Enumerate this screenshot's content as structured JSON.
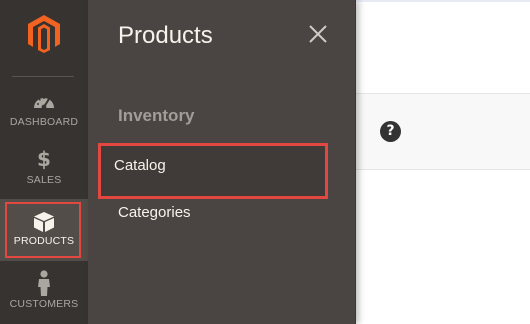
{
  "sidebar": {
    "logo_icon": "magento-logo",
    "items": [
      {
        "label": "DASHBOARD",
        "icon": "speedometer-icon",
        "active": false
      },
      {
        "label": "SALES",
        "icon": "dollar-icon",
        "active": false
      },
      {
        "label": "PRODUCTS",
        "icon": "box-icon",
        "active": true
      },
      {
        "label": "CUSTOMERS",
        "icon": "person-icon",
        "active": false
      }
    ]
  },
  "submenu": {
    "title": "Products",
    "close_icon": "close-icon",
    "section_title": "Inventory",
    "links": [
      {
        "label": "Catalog",
        "highlighted": true
      },
      {
        "label": "Categories",
        "highlighted": false
      }
    ]
  },
  "page": {
    "help_icon": "help-icon",
    "help_glyph": "?"
  },
  "colors": {
    "sidebar_bg": "#373330",
    "submenu_bg": "#4a4542",
    "active_item_bg": "#524d49",
    "highlight_border": "#e2483f",
    "logo_orange": "#f26322",
    "text_light": "#f7f3eb",
    "text_muted": "#a29d98"
  }
}
